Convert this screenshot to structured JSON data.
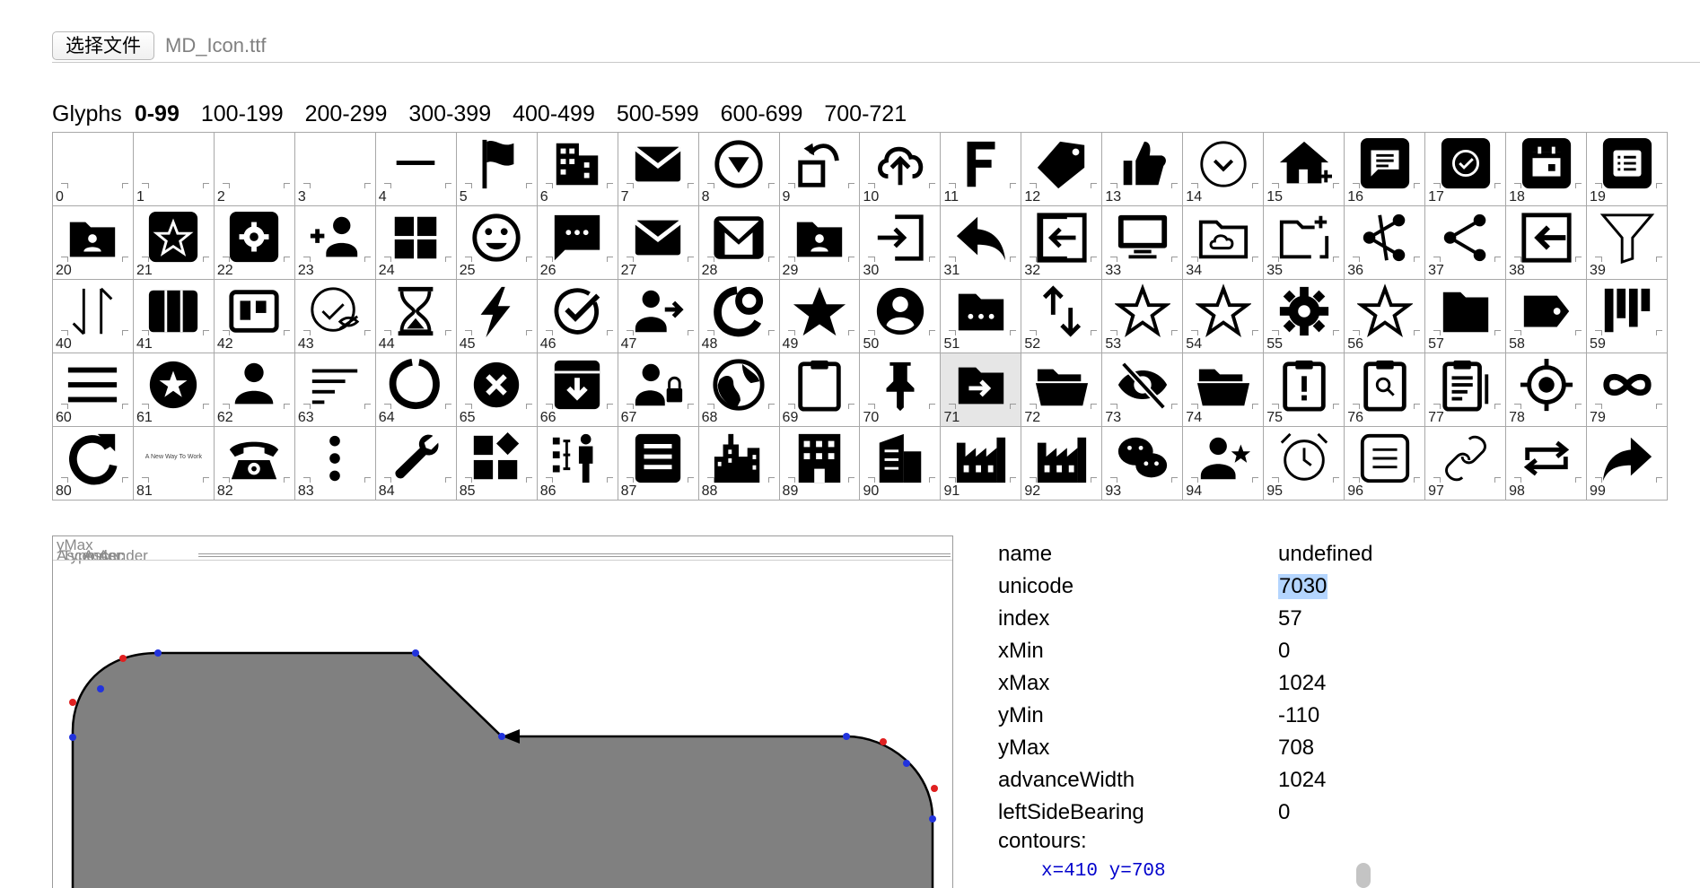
{
  "file": {
    "button_label": "选择文件",
    "file_name": "MD_Icon.ttf"
  },
  "glyph_nav": {
    "label": "Glyphs",
    "ranges": [
      "0-99",
      "100-199",
      "200-299",
      "300-399",
      "400-499",
      "500-599",
      "600-699",
      "700-721"
    ],
    "active": "0-99"
  },
  "grid": {
    "selected_index": "71",
    "cells": [
      {
        "n": "0",
        "icon": "empty-icon"
      },
      {
        "n": "1",
        "icon": "empty-icon"
      },
      {
        "n": "2",
        "icon": "empty-icon"
      },
      {
        "n": "3",
        "icon": "empty-icon"
      },
      {
        "n": "4",
        "icon": "minus-icon"
      },
      {
        "n": "5",
        "icon": "flag-icon"
      },
      {
        "n": "6",
        "icon": "building-icon"
      },
      {
        "n": "7",
        "icon": "mail-icon"
      },
      {
        "n": "8",
        "icon": "circle-down-icon"
      },
      {
        "n": "9",
        "icon": "rotate-icon"
      },
      {
        "n": "10",
        "icon": "cloud-upload-icon"
      },
      {
        "n": "11",
        "icon": "letter-f-icon"
      },
      {
        "n": "12",
        "icon": "tag-icon"
      },
      {
        "n": "13",
        "icon": "thumb-up-icon"
      },
      {
        "n": "14",
        "icon": "circle-chevron-icon"
      },
      {
        "n": "15",
        "icon": "home-add-icon"
      },
      {
        "n": "16",
        "icon": "chat-box-icon"
      },
      {
        "n": "17",
        "icon": "check-box-icon"
      },
      {
        "n": "18",
        "icon": "calendar-icon"
      },
      {
        "n": "19",
        "icon": "list-box-icon"
      },
      {
        "n": "20",
        "icon": "folder-user-icon"
      },
      {
        "n": "21",
        "icon": "star-box-icon"
      },
      {
        "n": "22",
        "icon": "settings-box-icon"
      },
      {
        "n": "23",
        "icon": "add-person-icon"
      },
      {
        "n": "24",
        "icon": "dashboard-icon"
      },
      {
        "n": "25",
        "icon": "smiley-icon"
      },
      {
        "n": "26",
        "icon": "message-icon"
      },
      {
        "n": "27",
        "icon": "mail-icon"
      },
      {
        "n": "28",
        "icon": "gmail-icon"
      },
      {
        "n": "29",
        "icon": "folder-user-icon"
      },
      {
        "n": "30",
        "icon": "login-icon"
      },
      {
        "n": "31",
        "icon": "reply-icon"
      },
      {
        "n": "32",
        "icon": "logout-icon"
      },
      {
        "n": "33",
        "icon": "monitor-icon"
      },
      {
        "n": "34",
        "icon": "folder-cloud-icon"
      },
      {
        "n": "35",
        "icon": "folder-add-icon"
      },
      {
        "n": "36",
        "icon": "share-alt-icon"
      },
      {
        "n": "37",
        "icon": "share-icon"
      },
      {
        "n": "38",
        "icon": "exit-box-icon"
      },
      {
        "n": "39",
        "icon": "filter-icon"
      },
      {
        "n": "40",
        "icon": "sort-arrows-icon"
      },
      {
        "n": "41",
        "icon": "columns-icon"
      },
      {
        "n": "42",
        "icon": "board-icon"
      },
      {
        "n": "43",
        "icon": "check-hidden-icon"
      },
      {
        "n": "44",
        "icon": "hourglass-icon"
      },
      {
        "n": "45",
        "icon": "bolt-icon"
      },
      {
        "n": "46",
        "icon": "check-circle-icon"
      },
      {
        "n": "47",
        "icon": "person-arrow-icon"
      },
      {
        "n": "48",
        "icon": "donut-icon"
      },
      {
        "n": "49",
        "icon": "star-icon"
      },
      {
        "n": "50",
        "icon": "account-circle-icon"
      },
      {
        "n": "51",
        "icon": "folder-more-icon"
      },
      {
        "n": "52",
        "icon": "swap-vert-icon"
      },
      {
        "n": "53",
        "icon": "star-outline-icon"
      },
      {
        "n": "54",
        "icon": "star-outline-icon"
      },
      {
        "n": "55",
        "icon": "gear-icon"
      },
      {
        "n": "56",
        "icon": "star-outline-icon"
      },
      {
        "n": "57",
        "icon": "folder-icon"
      },
      {
        "n": "58",
        "icon": "label-icon"
      },
      {
        "n": "59",
        "icon": "bars-icon"
      },
      {
        "n": "60",
        "icon": "menu-icon"
      },
      {
        "n": "61",
        "icon": "star-circle-icon"
      },
      {
        "n": "62",
        "icon": "person-icon"
      },
      {
        "n": "63",
        "icon": "sort-icon"
      },
      {
        "n": "64",
        "icon": "loading-ring-icon"
      },
      {
        "n": "65",
        "icon": "cancel-icon"
      },
      {
        "n": "66",
        "icon": "archive-icon"
      },
      {
        "n": "67",
        "icon": "person-lock-icon"
      },
      {
        "n": "68",
        "icon": "globe-icon"
      },
      {
        "n": "69",
        "icon": "clipboard-icon"
      },
      {
        "n": "70",
        "icon": "pin-icon"
      },
      {
        "n": "71",
        "icon": "folder-move-icon"
      },
      {
        "n": "72",
        "icon": "folder-open-icon"
      },
      {
        "n": "73",
        "icon": "eye-off-icon"
      },
      {
        "n": "74",
        "icon": "folder-open-icon"
      },
      {
        "n": "75",
        "icon": "clipboard-alert-icon"
      },
      {
        "n": "76",
        "icon": "clipboard-search-icon"
      },
      {
        "n": "77",
        "icon": "clipboard-edit-icon"
      },
      {
        "n": "78",
        "icon": "target-icon"
      },
      {
        "n": "79",
        "icon": "infinity-icon"
      },
      {
        "n": "80",
        "icon": "refresh-icon"
      },
      {
        "n": "81",
        "icon": "tagline-icon",
        "text": "A New Way To Work"
      },
      {
        "n": "82",
        "icon": "telephone-icon"
      },
      {
        "n": "83",
        "icon": "more-vert-icon"
      },
      {
        "n": "84",
        "icon": "wrench-icon"
      },
      {
        "n": "85",
        "icon": "widgets-icon"
      },
      {
        "n": "86",
        "icon": "org-person-icon"
      },
      {
        "n": "87",
        "icon": "document-icon"
      },
      {
        "n": "88",
        "icon": "city-icon"
      },
      {
        "n": "89",
        "icon": "apartment-icon"
      },
      {
        "n": "90",
        "icon": "office-icon"
      },
      {
        "n": "91",
        "icon": "factory-icon"
      },
      {
        "n": "92",
        "icon": "factory-icon"
      },
      {
        "n": "93",
        "icon": "wechat-icon"
      },
      {
        "n": "94",
        "icon": "person-star-icon"
      },
      {
        "n": "95",
        "icon": "alarm-icon"
      },
      {
        "n": "96",
        "icon": "notes-icon"
      },
      {
        "n": "97",
        "icon": "link-icon"
      },
      {
        "n": "98",
        "icon": "repeat-icon"
      },
      {
        "n": "99",
        "icon": "forward-icon"
      }
    ]
  },
  "preview": {
    "labels": [
      "yMax",
      "Ascender",
      "Typo Asc",
      "Ascender"
    ]
  },
  "properties": [
    {
      "key": "name",
      "value": "undefined"
    },
    {
      "key": "unicode",
      "value": "7030",
      "highlight": true
    },
    {
      "key": "index",
      "value": "57"
    },
    {
      "key": "xMin",
      "value": "0"
    },
    {
      "key": "xMax",
      "value": "1024"
    },
    {
      "key": "yMin",
      "value": "-110"
    },
    {
      "key": "yMax",
      "value": "708"
    },
    {
      "key": "advanceWidth",
      "value": "1024"
    },
    {
      "key": "leftSideBearing",
      "value": "0"
    }
  ],
  "contours": {
    "label": "contours:",
    "first_point": "x=410 y=708"
  },
  "colors": {
    "accent_blue": "#0000cc",
    "highlight": "#b4d5fe",
    "glyph_fill": "#808080",
    "on_curve_point": "#2233dd",
    "off_curve_point": "#e02020"
  }
}
